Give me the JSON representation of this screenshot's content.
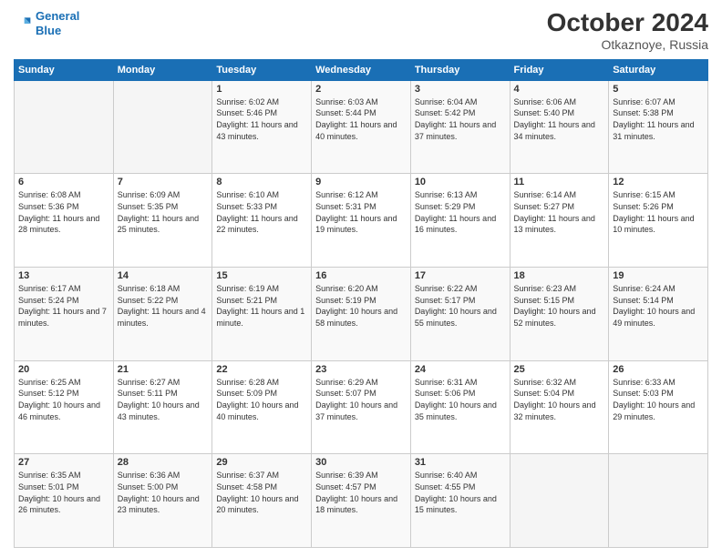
{
  "header": {
    "logo_line1": "General",
    "logo_line2": "Blue",
    "month_year": "October 2024",
    "location": "Otkaznoye, Russia"
  },
  "weekdays": [
    "Sunday",
    "Monday",
    "Tuesday",
    "Wednesday",
    "Thursday",
    "Friday",
    "Saturday"
  ],
  "weeks": [
    [
      {
        "day": "",
        "sunrise": "",
        "sunset": "",
        "daylight": ""
      },
      {
        "day": "",
        "sunrise": "",
        "sunset": "",
        "daylight": ""
      },
      {
        "day": "1",
        "sunrise": "Sunrise: 6:02 AM",
        "sunset": "Sunset: 5:46 PM",
        "daylight": "Daylight: 11 hours and 43 minutes."
      },
      {
        "day": "2",
        "sunrise": "Sunrise: 6:03 AM",
        "sunset": "Sunset: 5:44 PM",
        "daylight": "Daylight: 11 hours and 40 minutes."
      },
      {
        "day": "3",
        "sunrise": "Sunrise: 6:04 AM",
        "sunset": "Sunset: 5:42 PM",
        "daylight": "Daylight: 11 hours and 37 minutes."
      },
      {
        "day": "4",
        "sunrise": "Sunrise: 6:06 AM",
        "sunset": "Sunset: 5:40 PM",
        "daylight": "Daylight: 11 hours and 34 minutes."
      },
      {
        "day": "5",
        "sunrise": "Sunrise: 6:07 AM",
        "sunset": "Sunset: 5:38 PM",
        "daylight": "Daylight: 11 hours and 31 minutes."
      }
    ],
    [
      {
        "day": "6",
        "sunrise": "Sunrise: 6:08 AM",
        "sunset": "Sunset: 5:36 PM",
        "daylight": "Daylight: 11 hours and 28 minutes."
      },
      {
        "day": "7",
        "sunrise": "Sunrise: 6:09 AM",
        "sunset": "Sunset: 5:35 PM",
        "daylight": "Daylight: 11 hours and 25 minutes."
      },
      {
        "day": "8",
        "sunrise": "Sunrise: 6:10 AM",
        "sunset": "Sunset: 5:33 PM",
        "daylight": "Daylight: 11 hours and 22 minutes."
      },
      {
        "day": "9",
        "sunrise": "Sunrise: 6:12 AM",
        "sunset": "Sunset: 5:31 PM",
        "daylight": "Daylight: 11 hours and 19 minutes."
      },
      {
        "day": "10",
        "sunrise": "Sunrise: 6:13 AM",
        "sunset": "Sunset: 5:29 PM",
        "daylight": "Daylight: 11 hours and 16 minutes."
      },
      {
        "day": "11",
        "sunrise": "Sunrise: 6:14 AM",
        "sunset": "Sunset: 5:27 PM",
        "daylight": "Daylight: 11 hours and 13 minutes."
      },
      {
        "day": "12",
        "sunrise": "Sunrise: 6:15 AM",
        "sunset": "Sunset: 5:26 PM",
        "daylight": "Daylight: 11 hours and 10 minutes."
      }
    ],
    [
      {
        "day": "13",
        "sunrise": "Sunrise: 6:17 AM",
        "sunset": "Sunset: 5:24 PM",
        "daylight": "Daylight: 11 hours and 7 minutes."
      },
      {
        "day": "14",
        "sunrise": "Sunrise: 6:18 AM",
        "sunset": "Sunset: 5:22 PM",
        "daylight": "Daylight: 11 hours and 4 minutes."
      },
      {
        "day": "15",
        "sunrise": "Sunrise: 6:19 AM",
        "sunset": "Sunset: 5:21 PM",
        "daylight": "Daylight: 11 hours and 1 minute."
      },
      {
        "day": "16",
        "sunrise": "Sunrise: 6:20 AM",
        "sunset": "Sunset: 5:19 PM",
        "daylight": "Daylight: 10 hours and 58 minutes."
      },
      {
        "day": "17",
        "sunrise": "Sunrise: 6:22 AM",
        "sunset": "Sunset: 5:17 PM",
        "daylight": "Daylight: 10 hours and 55 minutes."
      },
      {
        "day": "18",
        "sunrise": "Sunrise: 6:23 AM",
        "sunset": "Sunset: 5:15 PM",
        "daylight": "Daylight: 10 hours and 52 minutes."
      },
      {
        "day": "19",
        "sunrise": "Sunrise: 6:24 AM",
        "sunset": "Sunset: 5:14 PM",
        "daylight": "Daylight: 10 hours and 49 minutes."
      }
    ],
    [
      {
        "day": "20",
        "sunrise": "Sunrise: 6:25 AM",
        "sunset": "Sunset: 5:12 PM",
        "daylight": "Daylight: 10 hours and 46 minutes."
      },
      {
        "day": "21",
        "sunrise": "Sunrise: 6:27 AM",
        "sunset": "Sunset: 5:11 PM",
        "daylight": "Daylight: 10 hours and 43 minutes."
      },
      {
        "day": "22",
        "sunrise": "Sunrise: 6:28 AM",
        "sunset": "Sunset: 5:09 PM",
        "daylight": "Daylight: 10 hours and 40 minutes."
      },
      {
        "day": "23",
        "sunrise": "Sunrise: 6:29 AM",
        "sunset": "Sunset: 5:07 PM",
        "daylight": "Daylight: 10 hours and 37 minutes."
      },
      {
        "day": "24",
        "sunrise": "Sunrise: 6:31 AM",
        "sunset": "Sunset: 5:06 PM",
        "daylight": "Daylight: 10 hours and 35 minutes."
      },
      {
        "day": "25",
        "sunrise": "Sunrise: 6:32 AM",
        "sunset": "Sunset: 5:04 PM",
        "daylight": "Daylight: 10 hours and 32 minutes."
      },
      {
        "day": "26",
        "sunrise": "Sunrise: 6:33 AM",
        "sunset": "Sunset: 5:03 PM",
        "daylight": "Daylight: 10 hours and 29 minutes."
      }
    ],
    [
      {
        "day": "27",
        "sunrise": "Sunrise: 6:35 AM",
        "sunset": "Sunset: 5:01 PM",
        "daylight": "Daylight: 10 hours and 26 minutes."
      },
      {
        "day": "28",
        "sunrise": "Sunrise: 6:36 AM",
        "sunset": "Sunset: 5:00 PM",
        "daylight": "Daylight: 10 hours and 23 minutes."
      },
      {
        "day": "29",
        "sunrise": "Sunrise: 6:37 AM",
        "sunset": "Sunset: 4:58 PM",
        "daylight": "Daylight: 10 hours and 20 minutes."
      },
      {
        "day": "30",
        "sunrise": "Sunrise: 6:39 AM",
        "sunset": "Sunset: 4:57 PM",
        "daylight": "Daylight: 10 hours and 18 minutes."
      },
      {
        "day": "31",
        "sunrise": "Sunrise: 6:40 AM",
        "sunset": "Sunset: 4:55 PM",
        "daylight": "Daylight: 10 hours and 15 minutes."
      },
      {
        "day": "",
        "sunrise": "",
        "sunset": "",
        "daylight": ""
      },
      {
        "day": "",
        "sunrise": "",
        "sunset": "",
        "daylight": ""
      }
    ]
  ]
}
